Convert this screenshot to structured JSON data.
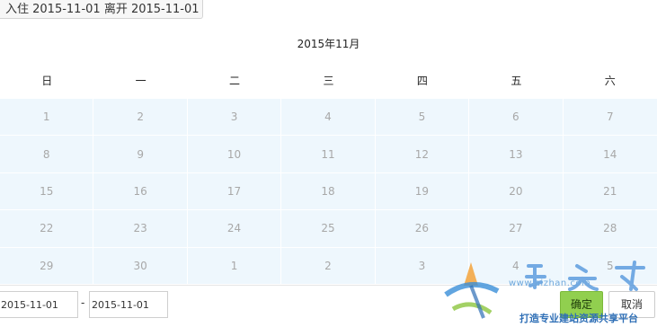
{
  "trigger": {
    "text": "入住 2015-11-01 离开 2015-11-01"
  },
  "calendar": {
    "title": "2015年11月",
    "weekdays": [
      "日",
      "一",
      "二",
      "三",
      "四",
      "五",
      "六"
    ],
    "days": [
      "1",
      "2",
      "3",
      "4",
      "5",
      "6",
      "7",
      "8",
      "9",
      "10",
      "11",
      "12",
      "13",
      "14",
      "15",
      "16",
      "17",
      "18",
      "19",
      "20",
      "21",
      "22",
      "23",
      "24",
      "25",
      "26",
      "27",
      "28",
      "29",
      "30",
      "1",
      "2",
      "3",
      "4",
      "5"
    ]
  },
  "footer": {
    "start_date": "2015-11-01",
    "separator": "-",
    "end_date": "2015-11-01",
    "confirm_label": "确定",
    "cancel_label": "取消"
  },
  "watermark": {
    "url": "www.aizhan.com",
    "slogan": "打造专业建站资源共享平台"
  },
  "colors": {
    "grid_bg": "#eef7fd",
    "confirm_bg": "#91cf4f",
    "day_text": "#a8a8a8"
  }
}
